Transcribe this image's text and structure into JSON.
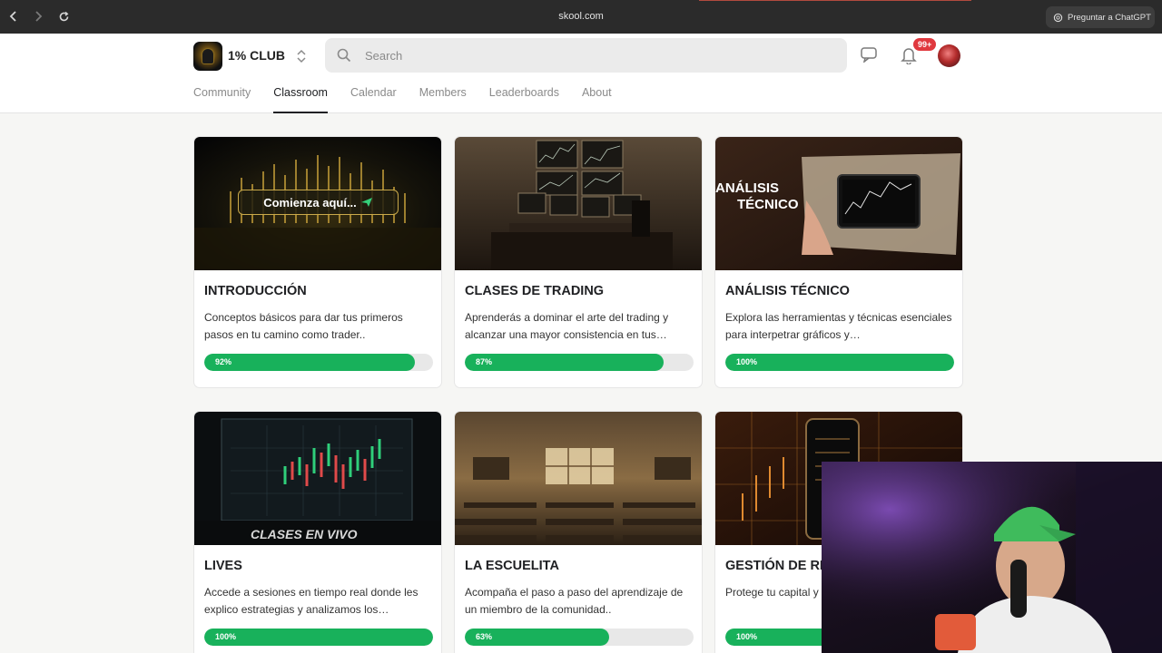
{
  "browser": {
    "url": "skool.com",
    "gpt_button_label": "Preguntar a ChatGPT"
  },
  "header": {
    "club_name": "1% CLUB",
    "search_placeholder": "Search",
    "notification_count": "99+"
  },
  "tabs": [
    {
      "label": "Community",
      "active": false
    },
    {
      "label": "Classroom",
      "active": true
    },
    {
      "label": "Calendar",
      "active": false
    },
    {
      "label": "Members",
      "active": false
    },
    {
      "label": "Leaderboards",
      "active": false
    },
    {
      "label": "About",
      "active": false
    }
  ],
  "thumbnail_text": {
    "intro_cta": "Comienza aquí...",
    "analisis_line1": "ANÁLISIS",
    "analisis_line2": "TÉCNICO",
    "lives_banner": "CLASES EN VIVO"
  },
  "courses": [
    {
      "title": "INTRODUCCIÓN",
      "description": "Conceptos básicos para dar tus primeros pasos en tu camino como trader..",
      "progress": 92,
      "progress_label": "92%"
    },
    {
      "title": "CLASES DE TRADING",
      "description": "Aprenderás a dominar el arte del trading y alcanzar una mayor consistencia en tus…",
      "progress": 87,
      "progress_label": "87%"
    },
    {
      "title": "ANÁLISIS TÉCNICO",
      "description": "Explora las herramientas y técnicas esenciales para interpetrar gráficos y…",
      "progress": 100,
      "progress_label": "100%"
    },
    {
      "title": "LIVES",
      "description": "Accede a sesiones en tiempo real donde les explico estrategias y analizamos los…",
      "progress": 100,
      "progress_label": "100%"
    },
    {
      "title": "LA ESCUELITA",
      "description": "Acompaña el paso a paso del aprendizaje de un miembro de la comunidad..",
      "progress": 63,
      "progress_label": "63%"
    },
    {
      "title": "GESTIÓN DE RI",
      "description": "Protege tu capital y plazo..",
      "progress": 100,
      "progress_label": "100%"
    }
  ],
  "colors": {
    "progress_fill": "#18b15b",
    "progress_track": "#e8e8e8",
    "badge": "#e0383e"
  }
}
